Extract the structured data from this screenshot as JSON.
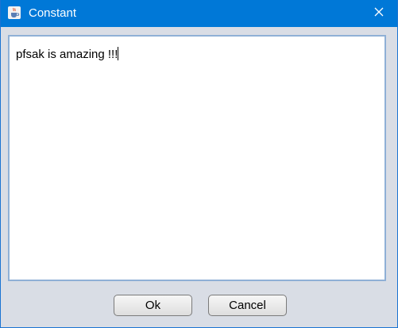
{
  "window": {
    "title": "Constant",
    "icon": "java-cup-icon",
    "close_icon": "close-icon"
  },
  "editor": {
    "text": "pfsak is amazing !!!"
  },
  "buttons": {
    "ok_label": "Ok",
    "cancel_label": "Cancel"
  },
  "colors": {
    "titlebar": "#0078d7",
    "dialog_bg": "#d9dde5",
    "text_border": "#8fb0d6"
  }
}
